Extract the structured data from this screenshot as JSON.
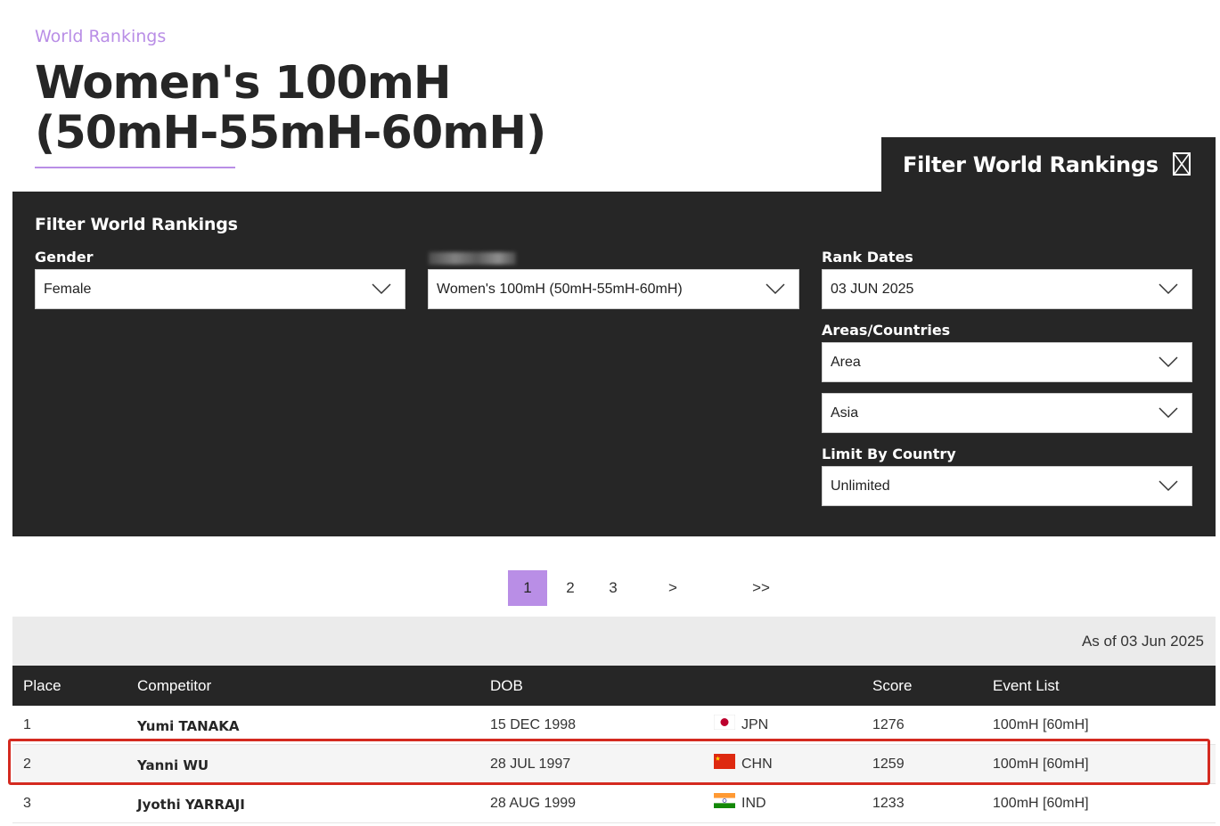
{
  "header": {
    "breadcrumb": "World Rankings",
    "title": "Women's 100mH (50mH-55mH-60mH)"
  },
  "filter_tab": {
    "title": "Filter World Rankings",
    "close_icon": "close-x-icon"
  },
  "filter_panel": {
    "title": "Filter World Rankings",
    "gender": {
      "label": "Gender",
      "value": "Female"
    },
    "discipline": {
      "value": "Women's 100mH (50mH-55mH-60mH)"
    },
    "rank_dates": {
      "label": "Rank Dates",
      "value": "03 JUN 2025"
    },
    "areas": {
      "label": "Areas/Countries",
      "type_value": "Area",
      "area_value": "Asia"
    },
    "limit": {
      "label": "Limit By Country",
      "value": "Unlimited"
    }
  },
  "pagination": {
    "pages": [
      "1",
      "2",
      "3"
    ],
    "current": "1",
    "next": ">",
    "last": ">>"
  },
  "as_of": "As of 03 Jun 2025",
  "table": {
    "headers": {
      "place": "Place",
      "competitor": "Competitor",
      "dob": "DOB",
      "score": "Score",
      "events": "Event List"
    },
    "rows": [
      {
        "place": "1",
        "name": "Yumi TANAKA",
        "dob": "15 DEC 1998",
        "country": "JPN",
        "flag": "japan-flag-icon",
        "score": "1276",
        "events": "100mH [60mH]"
      },
      {
        "place": "2",
        "name": "Yanni WU",
        "dob": "28 JUL 1997",
        "country": "CHN",
        "flag": "china-flag-icon",
        "score": "1259",
        "events": "100mH [60mH]"
      },
      {
        "place": "3",
        "name": "Jyothi YARRAJI",
        "dob": "28 AUG 1999",
        "country": "IND",
        "flag": "india-flag-icon",
        "score": "1233",
        "events": "100mH [60mH]"
      }
    ]
  },
  "colors": {
    "accent": "#b98ee6",
    "dark": "#262626",
    "highlight": "#d42a20"
  }
}
